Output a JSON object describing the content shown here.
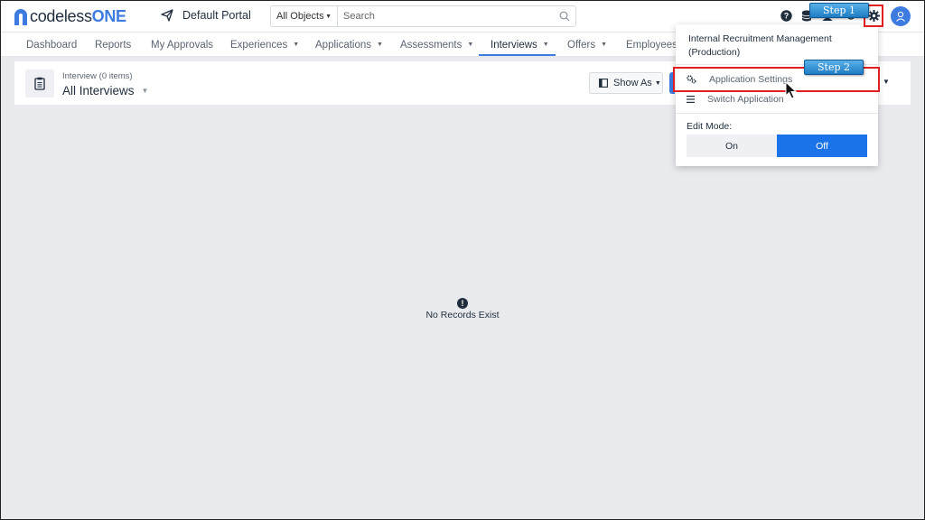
{
  "brand": {
    "name_part1": "codeless",
    "name_part2": "ONE",
    "accent": "#3d7be0"
  },
  "portal": {
    "label": "Default Portal",
    "icon": "paper-plane-icon"
  },
  "search": {
    "scope": "All Objects",
    "placeholder": "Search"
  },
  "topbar_icons": [
    "help-icon",
    "database-icon",
    "user-icon",
    "history-icon",
    "gear-icon",
    "avatar-icon"
  ],
  "nav": {
    "items": [
      {
        "label": "Dashboard",
        "dropdown": false
      },
      {
        "label": "Reports",
        "dropdown": false
      },
      {
        "label": "My Approvals",
        "dropdown": false
      },
      {
        "label": "Experiences",
        "dropdown": true
      },
      {
        "label": "Applications",
        "dropdown": true
      },
      {
        "label": "Assessments",
        "dropdown": true
      },
      {
        "label": "Interviews",
        "dropdown": true,
        "active": true
      },
      {
        "label": "Offers",
        "dropdown": true
      },
      {
        "label": "Employees",
        "dropdown": false
      }
    ]
  },
  "header": {
    "subtitle": "Interview (0 items)",
    "title": "All Interviews",
    "show_as": "Show As"
  },
  "empty_state": {
    "message": "No Records Exist"
  },
  "dropdown": {
    "title": "Internal Recruitment Management (Production)",
    "items": [
      {
        "label": "Application Settings",
        "icon": "settings-cogs-icon"
      },
      {
        "label": "Switch Application",
        "icon": "list-icon"
      }
    ],
    "edit_mode_label": "Edit Mode:",
    "edit_on": "On",
    "edit_off": "Off",
    "edit_selected": "Off",
    "toggle_active_color": "#1a73e8"
  },
  "annotations": {
    "step1": "Step 1",
    "step2": "Step 2",
    "highlight_color": "#e02020"
  }
}
